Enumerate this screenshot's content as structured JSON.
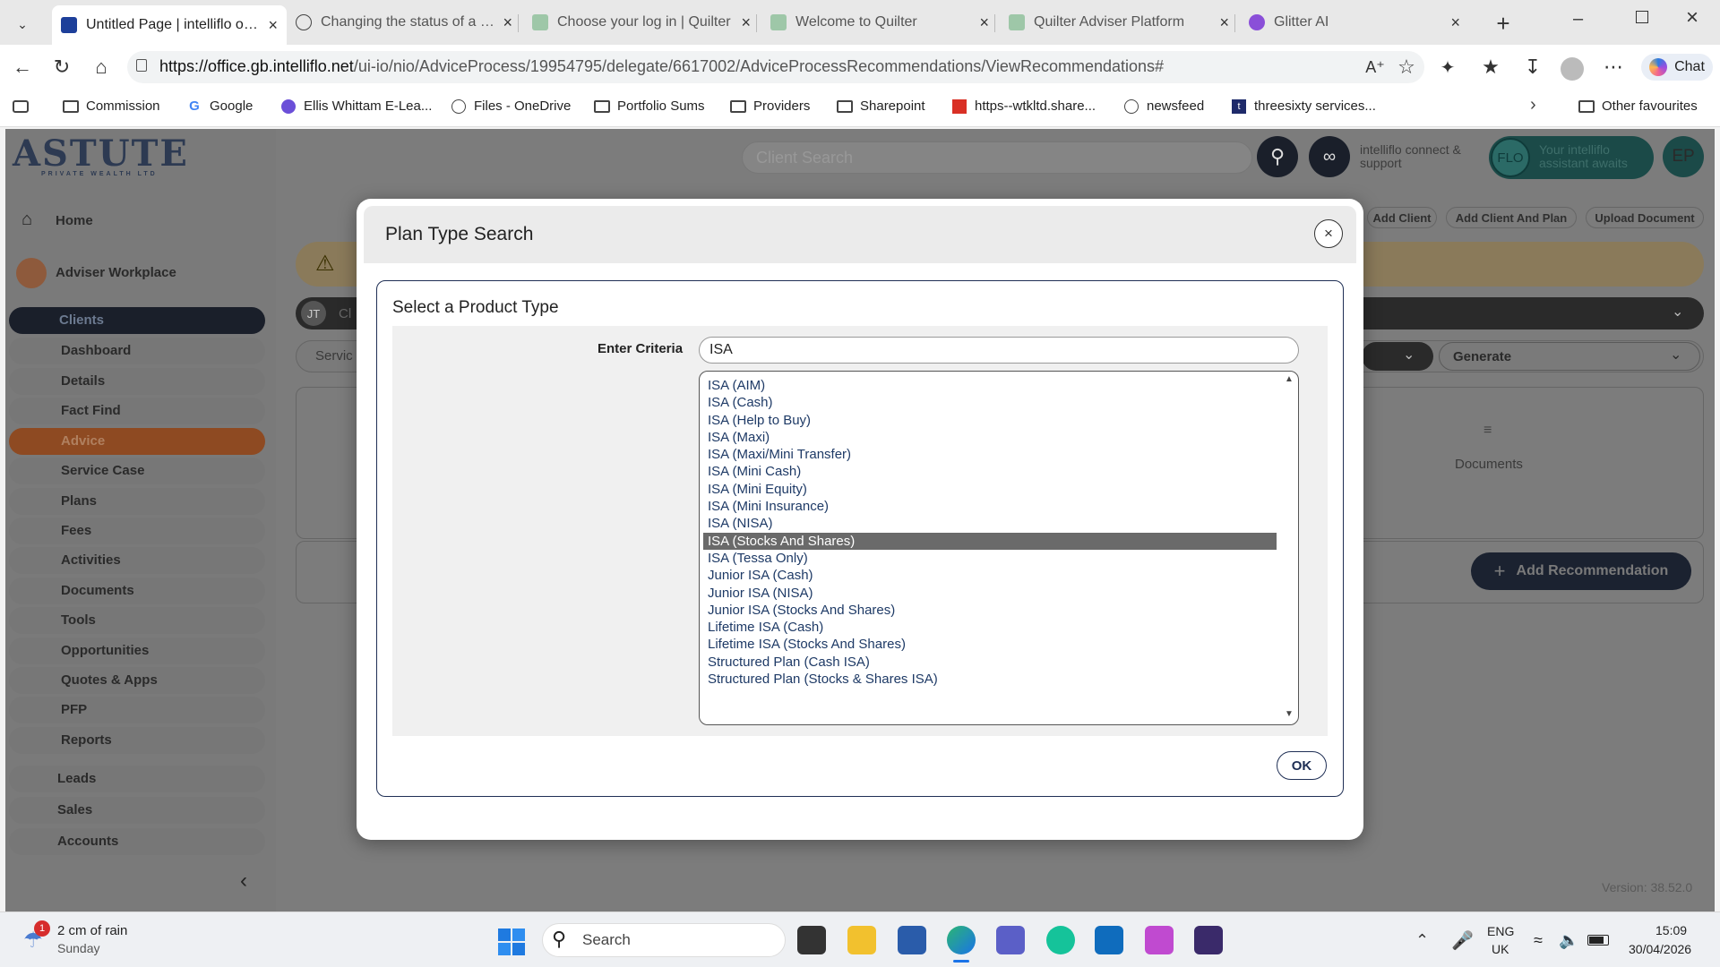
{
  "browser": {
    "tabs": [
      {
        "title": "Untitled Page | intelliflo office",
        "fav": "intelliflo-icon"
      },
      {
        "title": "Changing the status of a plan",
        "fav": "globe-icon"
      },
      {
        "title": "Choose your log in | Quilter",
        "fav": "quilter-icon"
      },
      {
        "title": "Welcome to Quilter",
        "fav": "quilter-icon"
      },
      {
        "title": "Quilter Adviser Platform",
        "fav": "quilter-icon"
      },
      {
        "title": "Glitter AI",
        "fav": "glitter-icon"
      }
    ],
    "url_domain": "https://office.gb.intelliflo.net",
    "url_path": "/ui-io/nio/AdviceProcess/19954795/delegate/6617002/AdviceProcessRecommendations/ViewRecommendations#",
    "chat_label": "Chat",
    "bookmarks": [
      "Commission",
      "Google",
      "Ellis Whittam E-Lea...",
      "Files - OneDrive",
      "Portfolio Sums",
      "Providers",
      "Sharepoint",
      "https--wtkltd.share...",
      "newsfeed",
      "threesixty services..."
    ],
    "other_favourites": "Other favourites"
  },
  "app": {
    "logo_main": "ASTUTE",
    "logo_sub": "PRIVATE WEALTH LTD",
    "client_search_placeholder": "Client Search",
    "connect_label": "intelliflo connect & support",
    "flo_label": "Your intelliflo assistant awaits",
    "flo_badge": "FLO",
    "avatar": "EP",
    "header_buttons": [
      "Add Client",
      "Add Client And Plan",
      "Upload Document"
    ],
    "sidebar": {
      "home": "Home",
      "workplace": "Adviser Workplace",
      "items": [
        "Clients",
        "Dashboard",
        "Details",
        "Fact Find",
        "Advice",
        "Service Case",
        "Plans",
        "Fees",
        "Activities",
        "Documents",
        "Tools",
        "Opportunities",
        "Quotes & Apps",
        "PFP",
        "Reports"
      ],
      "bottom_items": [
        "Leads",
        "Sales",
        "Accounts"
      ]
    },
    "client_initials": "JT",
    "client_fragment": "Cl",
    "service_fragment": "Servic",
    "generate_label": "Generate",
    "documents_label": "Documents",
    "add_recommendation": "Add Recommendation",
    "version": "Version: 38.52.0"
  },
  "modal": {
    "title": "Plan Type Search",
    "subtitle": "Select a Product Type",
    "criteria_label": "Enter Criteria",
    "criteria_value": "ISA",
    "options": [
      "ISA (AIM)",
      "ISA (Cash)",
      "ISA (Help to Buy)",
      "ISA (Maxi)",
      "ISA (Maxi/Mini Transfer)",
      "ISA (Mini Cash)",
      "ISA (Mini Equity)",
      "ISA (Mini Insurance)",
      "ISA (NISA)",
      "ISA (Stocks And Shares)",
      "ISA (Tessa Only)",
      "Junior ISA (Cash)",
      "Junior ISA (NISA)",
      "Junior ISA (Stocks And Shares)",
      "Lifetime ISA (Cash)",
      "Lifetime ISA (Stocks And Shares)",
      "Structured Plan (Cash ISA)",
      "Structured Plan (Stocks & Shares ISA)"
    ],
    "selected": "ISA (Stocks And Shares)",
    "ok_label": "OK",
    "close_glyph": "×"
  },
  "taskbar": {
    "weather_badge": "1",
    "weather_line1": "2 cm of rain",
    "weather_line2": "Sunday",
    "search_label": "Search",
    "lang1": "ENG",
    "lang2": "UK",
    "time": "15:09",
    "date": "30/04/2026"
  }
}
